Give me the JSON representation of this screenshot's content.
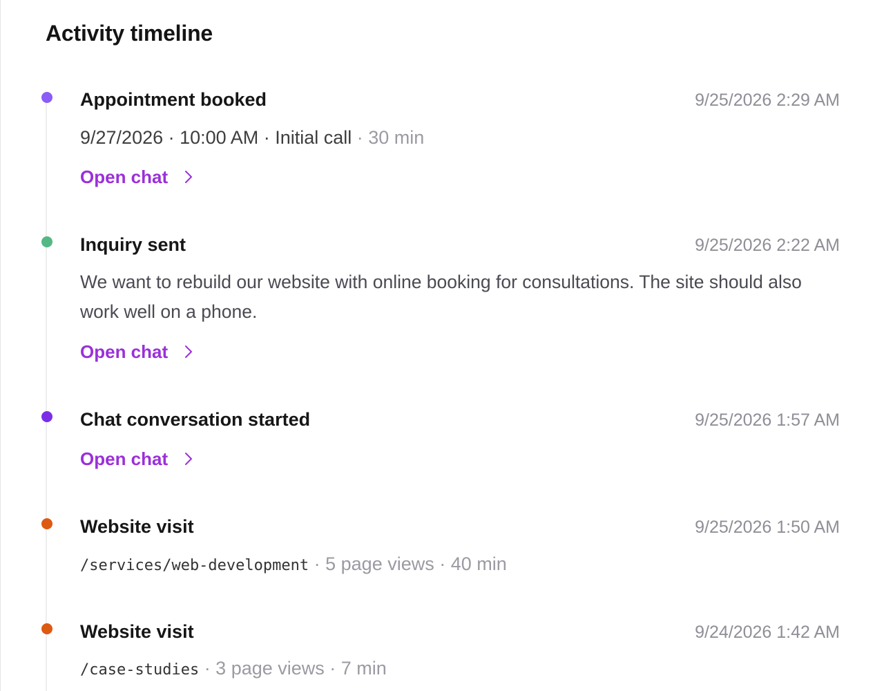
{
  "title": "Activity timeline",
  "colors": {
    "purple_dot": "#8b5cf6",
    "green_dot": "#55b884",
    "violet_dot": "#7c2ee6",
    "orange_dot": "#dc5a12",
    "link": "#9b30d9"
  },
  "events": [
    {
      "title": "Appointment booked",
      "time": "9/25/2026 2:29 AM",
      "date": "9/27/2026",
      "sep1": " · ",
      "clock": "10:00 AM",
      "sep2": " · ",
      "type": "Initial call",
      "duration": " · 30 min",
      "link": "Open chat",
      "dot_color": "purple"
    },
    {
      "title": "Inquiry sent",
      "time": "9/25/2026 2:22 AM",
      "message": "We want to rebuild our website with online booking for consultations. The site should also work well on a phone.",
      "link": "Open chat",
      "dot_color": "green"
    },
    {
      "title": "Chat conversation started",
      "time": "9/25/2026 1:57 AM",
      "link": "Open chat",
      "dot_color": "violet"
    },
    {
      "title": "Website visit",
      "time": "9/25/2026 1:50 AM",
      "path": "/services/web-development",
      "stats": " · 5 page views · 40 min",
      "dot_color": "orange"
    },
    {
      "title": "Website visit",
      "time": "9/24/2026 1:42 AM",
      "path": "/case-studies",
      "stats": " · 3 page views · 7 min",
      "dot_color": "orange"
    }
  ],
  "icons": {
    "link_chevron": "chevron-right-icon"
  }
}
